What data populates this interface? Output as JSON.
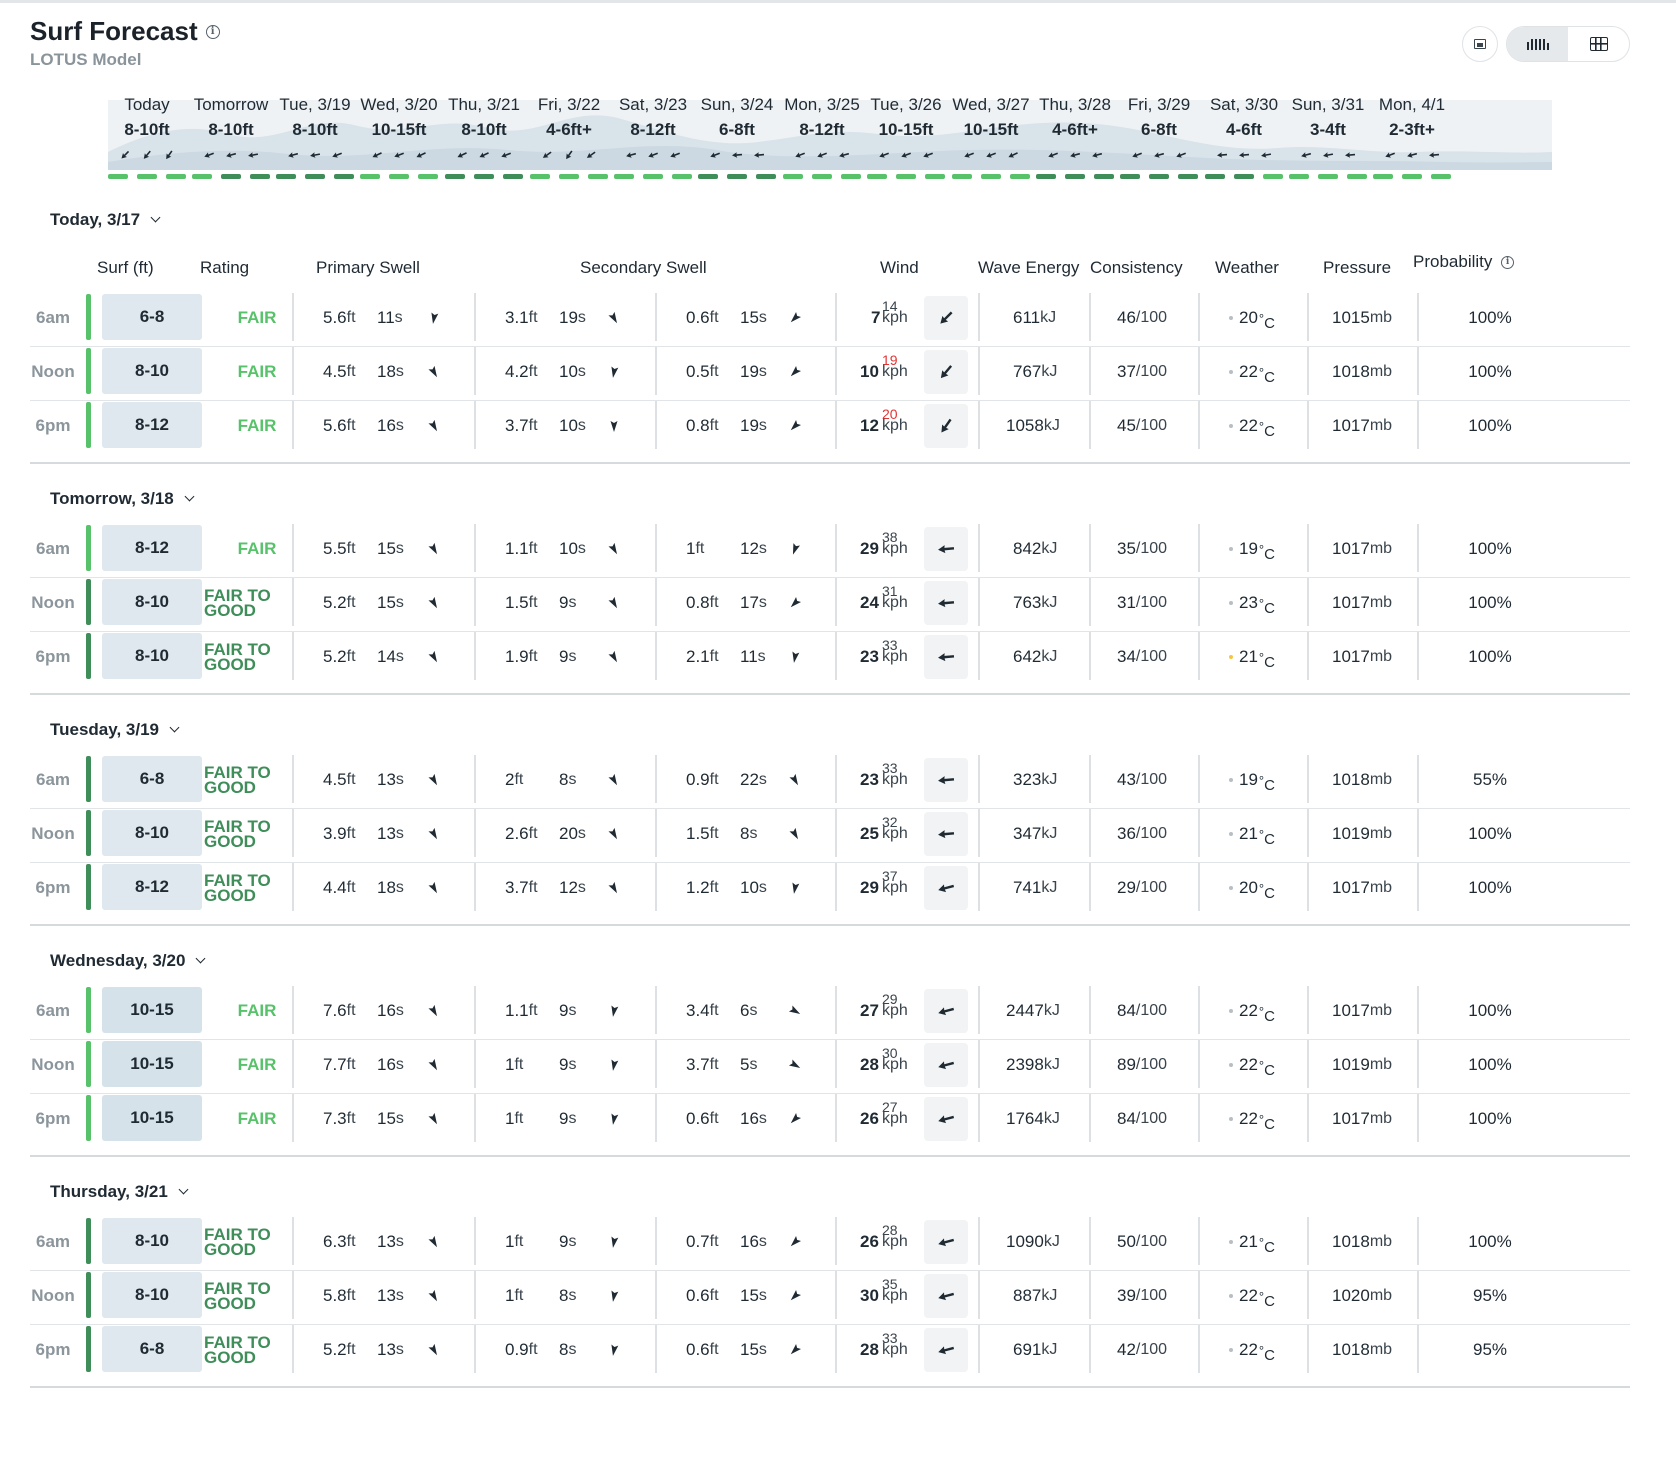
{
  "header": {
    "title": "Surf Forecast",
    "subtitle": "LOTUS Model",
    "info_icon": "info-icon",
    "view_icons": [
      "list-icon",
      "bar-chart-icon",
      "grid-icon"
    ]
  },
  "strip": [
    {
      "day": "Today",
      "surf": "8-10ft",
      "arrows": [
        225,
        220,
        215
      ],
      "ratings": [
        "fair",
        "fair",
        "fair"
      ]
    },
    {
      "day": "Tomorrow",
      "surf": "8-10ft",
      "arrows": [
        250,
        255,
        260
      ],
      "ratings": [
        "fair",
        "good",
        "good"
      ]
    },
    {
      "day": "Tue, 3/19",
      "surf": "8-10ft",
      "arrows": [
        255,
        260,
        250
      ],
      "ratings": [
        "good",
        "good",
        "good"
      ]
    },
    {
      "day": "Wed, 3/20",
      "surf": "10-15ft",
      "arrows": [
        245,
        250,
        245
      ],
      "ratings": [
        "fair",
        "fair",
        "fair"
      ]
    },
    {
      "day": "Thu, 3/21",
      "surf": "8-10ft",
      "arrows": [
        245,
        245,
        250
      ],
      "ratings": [
        "good",
        "good",
        "good"
      ]
    },
    {
      "day": "Fri, 3/22",
      "surf": "4-6ft+",
      "arrows": [
        235,
        215,
        235
      ],
      "ratings": [
        "fair",
        "fair",
        "fair"
      ]
    },
    {
      "day": "Sat, 3/23",
      "surf": "8-12ft",
      "arrows": [
        255,
        250,
        250
      ],
      "ratings": [
        "fair",
        "fair",
        "fair"
      ]
    },
    {
      "day": "Sun, 3/24",
      "surf": "6-8ft",
      "arrows": [
        250,
        265,
        265
      ],
      "ratings": [
        "good",
        "good",
        "good"
      ]
    },
    {
      "day": "Mon, 3/25",
      "surf": "8-12ft",
      "arrows": [
        250,
        250,
        255
      ],
      "ratings": [
        "fair",
        "fair",
        "fair"
      ]
    },
    {
      "day": "Tue, 3/26",
      "surf": "10-15ft",
      "arrows": [
        250,
        250,
        250
      ],
      "ratings": [
        "fair",
        "fair",
        "fair"
      ]
    },
    {
      "day": "Wed, 3/27",
      "surf": "10-15ft",
      "arrows": [
        250,
        250,
        245
      ],
      "ratings": [
        "fair",
        "fair",
        "fair"
      ]
    },
    {
      "day": "Thu, 3/28",
      "surf": "4-6ft+",
      "arrows": [
        250,
        255,
        255
      ],
      "ratings": [
        "good",
        "good",
        "good"
      ]
    },
    {
      "day": "Fri, 3/29",
      "surf": "6-8ft",
      "arrows": [
        250,
        255,
        250
      ],
      "ratings": [
        "good",
        "good",
        "good"
      ]
    },
    {
      "day": "Sat, 3/30",
      "surf": "4-6ft",
      "arrows": [
        265,
        265,
        260
      ],
      "ratings": [
        "good",
        "good",
        "fair"
      ]
    },
    {
      "day": "Sun, 3/31",
      "surf": "3-4ft",
      "arrows": [
        255,
        260,
        265
      ],
      "ratings": [
        "fair",
        "fair",
        "fair"
      ]
    },
    {
      "day": "Mon, 4/1",
      "surf": "2-3ft+",
      "arrows": [
        250,
        255,
        265
      ],
      "ratings": [
        "fair",
        "fair",
        "fair"
      ]
    }
  ],
  "columns": {
    "surf": "Surf (ft)",
    "rating": "Rating",
    "primary": "Primary Swell",
    "secondary": "Secondary Swell",
    "wind": "Wind",
    "energy": "Wave Energy",
    "consistency": "Consistency",
    "weather": "Weather",
    "pressure": "Pressure",
    "probability": "Probability"
  },
  "units": {
    "ft": "ft",
    "s": "s",
    "kph": "kph",
    "kj": "kJ",
    "of100": "/100",
    "deg": "°",
    "c": "C",
    "mb": "mb"
  },
  "colors": {
    "fair": "#57c26a",
    "good": "#3f8e5a",
    "surf_box_fair": "#dfe8ee",
    "surf_box_big": "#d5e2ea"
  },
  "days": [
    {
      "label": "Today, 3/17",
      "rows": [
        {
          "time": "6am",
          "surf": "6-8",
          "rating": "FAIR",
          "p_h": "5.6",
          "p_t": "11",
          "p_d": 190,
          "s_h": "3.1",
          "s_t": "19",
          "s_d": 150,
          "t_h": "0.6",
          "t_t": "15",
          "t_d": 225,
          "wind": "7",
          "gust": "14",
          "gust_red": false,
          "w_d": 225,
          "energy": "611",
          "cons": "46",
          "wx": "cloud",
          "temp": "20",
          "press": "1015",
          "prob": "100%"
        },
        {
          "time": "Noon",
          "surf": "8-10",
          "rating": "FAIR",
          "p_h": "4.5",
          "p_t": "18",
          "p_d": 150,
          "s_h": "4.2",
          "s_t": "10",
          "s_d": 190,
          "t_h": "0.5",
          "t_t": "19",
          "t_d": 225,
          "wind": "10",
          "gust": "19",
          "gust_red": true,
          "w_d": 220,
          "energy": "767",
          "cons": "37",
          "wx": "cloud",
          "temp": "22",
          "press": "1018",
          "prob": "100%"
        },
        {
          "time": "6pm",
          "surf": "8-12",
          "rating": "FAIR",
          "p_h": "5.6",
          "p_t": "16",
          "p_d": 150,
          "s_h": "3.7",
          "s_t": "10",
          "s_d": 180,
          "t_h": "0.8",
          "t_t": "19",
          "t_d": 225,
          "wind": "12",
          "gust": "20",
          "gust_red": true,
          "w_d": 215,
          "energy": "1058",
          "cons": "45",
          "wx": "cloud",
          "temp": "22",
          "press": "1017",
          "prob": "100%"
        }
      ]
    },
    {
      "label": "Tomorrow, 3/18",
      "rows": [
        {
          "time": "6am",
          "surf": "8-12",
          "rating": "FAIR",
          "p_h": "5.5",
          "p_t": "15",
          "p_d": 150,
          "s_h": "1.1",
          "s_t": "10",
          "s_d": 150,
          "t_h": "1",
          "t_t": "12",
          "t_d": 200,
          "wind": "29",
          "gust": "38",
          "gust_red": false,
          "w_d": 265,
          "energy": "842",
          "cons": "35",
          "wx": "cloud",
          "temp": "19",
          "press": "1017",
          "prob": "100%"
        },
        {
          "time": "Noon",
          "surf": "8-10",
          "rating": "FAIR TO GOOD",
          "p_h": "5.2",
          "p_t": "15",
          "p_d": 150,
          "s_h": "1.5",
          "s_t": "9",
          "s_d": 150,
          "t_h": "0.8",
          "t_t": "17",
          "t_d": 225,
          "wind": "24",
          "gust": "31",
          "gust_red": false,
          "w_d": 265,
          "energy": "763",
          "cons": "31",
          "wx": "cloud",
          "temp": "23",
          "press": "1017",
          "prob": "100%"
        },
        {
          "time": "6pm",
          "surf": "8-10",
          "rating": "FAIR TO GOOD",
          "p_h": "5.2",
          "p_t": "14",
          "p_d": 150,
          "s_h": "1.9",
          "s_t": "9",
          "s_d": 150,
          "t_h": "2.1",
          "t_t": "11",
          "t_d": 190,
          "wind": "23",
          "gust": "33",
          "gust_red": false,
          "w_d": 265,
          "energy": "642",
          "cons": "34",
          "wx": "sun",
          "temp": "21",
          "press": "1017",
          "prob": "100%"
        }
      ]
    },
    {
      "label": "Tuesday, 3/19",
      "rows": [
        {
          "time": "6am",
          "surf": "6-8",
          "rating": "FAIR TO GOOD",
          "p_h": "4.5",
          "p_t": "13",
          "p_d": 150,
          "s_h": "2",
          "s_t": "8",
          "s_d": 150,
          "t_h": "0.9",
          "t_t": "22",
          "t_d": 150,
          "wind": "23",
          "gust": "33",
          "gust_red": false,
          "w_d": 265,
          "energy": "323",
          "cons": "43",
          "wx": "cloud",
          "temp": "19",
          "press": "1018",
          "prob": "55%"
        },
        {
          "time": "Noon",
          "surf": "8-10",
          "rating": "FAIR TO GOOD",
          "p_h": "3.9",
          "p_t": "13",
          "p_d": 150,
          "s_h": "2.6",
          "s_t": "20",
          "s_d": 150,
          "t_h": "1.5",
          "t_t": "8",
          "t_d": 150,
          "wind": "25",
          "gust": "32",
          "gust_red": false,
          "w_d": 265,
          "energy": "347",
          "cons": "36",
          "wx": "cloud",
          "temp": "21",
          "press": "1019",
          "prob": "100%"
        },
        {
          "time": "6pm",
          "surf": "8-12",
          "rating": "FAIR TO GOOD",
          "p_h": "4.4",
          "p_t": "18",
          "p_d": 150,
          "s_h": "3.7",
          "s_t": "12",
          "s_d": 150,
          "t_h": "1.2",
          "t_t": "10",
          "t_d": 190,
          "wind": "29",
          "gust": "37",
          "gust_red": false,
          "w_d": 255,
          "energy": "741",
          "cons": "29",
          "wx": "cloud",
          "temp": "20",
          "press": "1017",
          "prob": "100%"
        }
      ]
    },
    {
      "label": "Wednesday, 3/20",
      "rows": [
        {
          "time": "6am",
          "surf": "10-15",
          "rating": "FAIR",
          "p_h": "7.6",
          "p_t": "16",
          "p_d": 150,
          "s_h": "1.1",
          "s_t": "9",
          "s_d": 190,
          "t_h": "3.4",
          "t_t": "6",
          "t_d": 120,
          "wind": "27",
          "gust": "29",
          "gust_red": false,
          "w_d": 255,
          "energy": "2447",
          "cons": "84",
          "wx": "cloud",
          "temp": "22",
          "press": "1017",
          "prob": "100%"
        },
        {
          "time": "Noon",
          "surf": "10-15",
          "rating": "FAIR",
          "p_h": "7.7",
          "p_t": "16",
          "p_d": 150,
          "s_h": "1",
          "s_t": "9",
          "s_d": 190,
          "t_h": "3.7",
          "t_t": "5",
          "t_d": 120,
          "wind": "28",
          "gust": "30",
          "gust_red": false,
          "w_d": 255,
          "energy": "2398",
          "cons": "89",
          "wx": "cloud",
          "temp": "22",
          "press": "1019",
          "prob": "100%"
        },
        {
          "time": "6pm",
          "surf": "10-15",
          "rating": "FAIR",
          "p_h": "7.3",
          "p_t": "15",
          "p_d": 150,
          "s_h": "1",
          "s_t": "9",
          "s_d": 190,
          "t_h": "0.6",
          "t_t": "16",
          "t_d": 225,
          "wind": "26",
          "gust": "27",
          "gust_red": false,
          "w_d": 255,
          "energy": "1764",
          "cons": "84",
          "wx": "cloud",
          "temp": "22",
          "press": "1017",
          "prob": "100%"
        }
      ]
    },
    {
      "label": "Thursday, 3/21",
      "rows": [
        {
          "time": "6am",
          "surf": "8-10",
          "rating": "FAIR TO GOOD",
          "p_h": "6.3",
          "p_t": "13",
          "p_d": 150,
          "s_h": "1",
          "s_t": "9",
          "s_d": 190,
          "t_h": "0.7",
          "t_t": "16",
          "t_d": 225,
          "wind": "26",
          "gust": "28",
          "gust_red": false,
          "w_d": 255,
          "energy": "1090",
          "cons": "50",
          "wx": "cloud",
          "temp": "21",
          "press": "1018",
          "prob": "100%"
        },
        {
          "time": "Noon",
          "surf": "8-10",
          "rating": "FAIR TO GOOD",
          "p_h": "5.8",
          "p_t": "13",
          "p_d": 150,
          "s_h": "1",
          "s_t": "8",
          "s_d": 190,
          "t_h": "0.6",
          "t_t": "15",
          "t_d": 225,
          "wind": "30",
          "gust": "35",
          "gust_red": false,
          "w_d": 255,
          "energy": "887",
          "cons": "39",
          "wx": "cloud",
          "temp": "22",
          "press": "1020",
          "prob": "95%"
        },
        {
          "time": "6pm",
          "surf": "6-8",
          "rating": "FAIR TO GOOD",
          "p_h": "5.2",
          "p_t": "13",
          "p_d": 150,
          "s_h": "0.9",
          "s_t": "8",
          "s_d": 190,
          "t_h": "0.6",
          "t_t": "15",
          "t_d": 225,
          "wind": "28",
          "gust": "33",
          "gust_red": false,
          "w_d": 255,
          "energy": "691",
          "cons": "42",
          "wx": "cloud",
          "temp": "22",
          "press": "1018",
          "prob": "95%"
        }
      ]
    }
  ]
}
